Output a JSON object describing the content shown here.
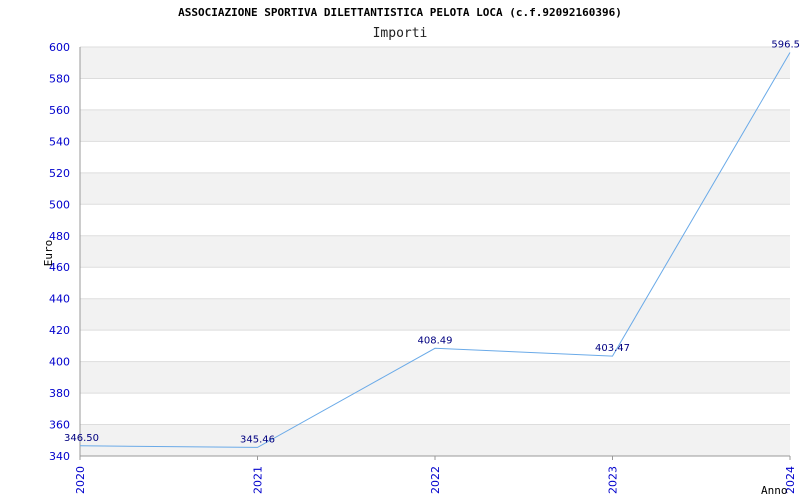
{
  "chart_data": {
    "type": "line",
    "title": "ASSOCIAZIONE SPORTIVA DILETTANTISTICA PELOTA LOCA (c.f.92092160396)",
    "subtitle": "Importi",
    "xlabel": "Anno",
    "ylabel": "Euro",
    "categories": [
      "2020",
      "2021",
      "2022",
      "2023",
      "2024"
    ],
    "values": [
      346.5,
      345.46,
      408.49,
      403.47,
      596.5
    ],
    "value_labels": [
      "346.50",
      "345.46",
      "408.49",
      "403.47",
      "596.5"
    ],
    "ylim": [
      340,
      600
    ],
    "yticks": [
      "340",
      "360",
      "380",
      "400",
      "420",
      "440",
      "460",
      "480",
      "500",
      "520",
      "540",
      "560",
      "580",
      "600"
    ],
    "grid": true,
    "colors": {
      "line": "#6aaae8",
      "band": "#f2f2f2",
      "gridline": "#dddddd",
      "axis": "#999999",
      "tick_text": "#0000cc",
      "data_label": "#000080"
    }
  }
}
